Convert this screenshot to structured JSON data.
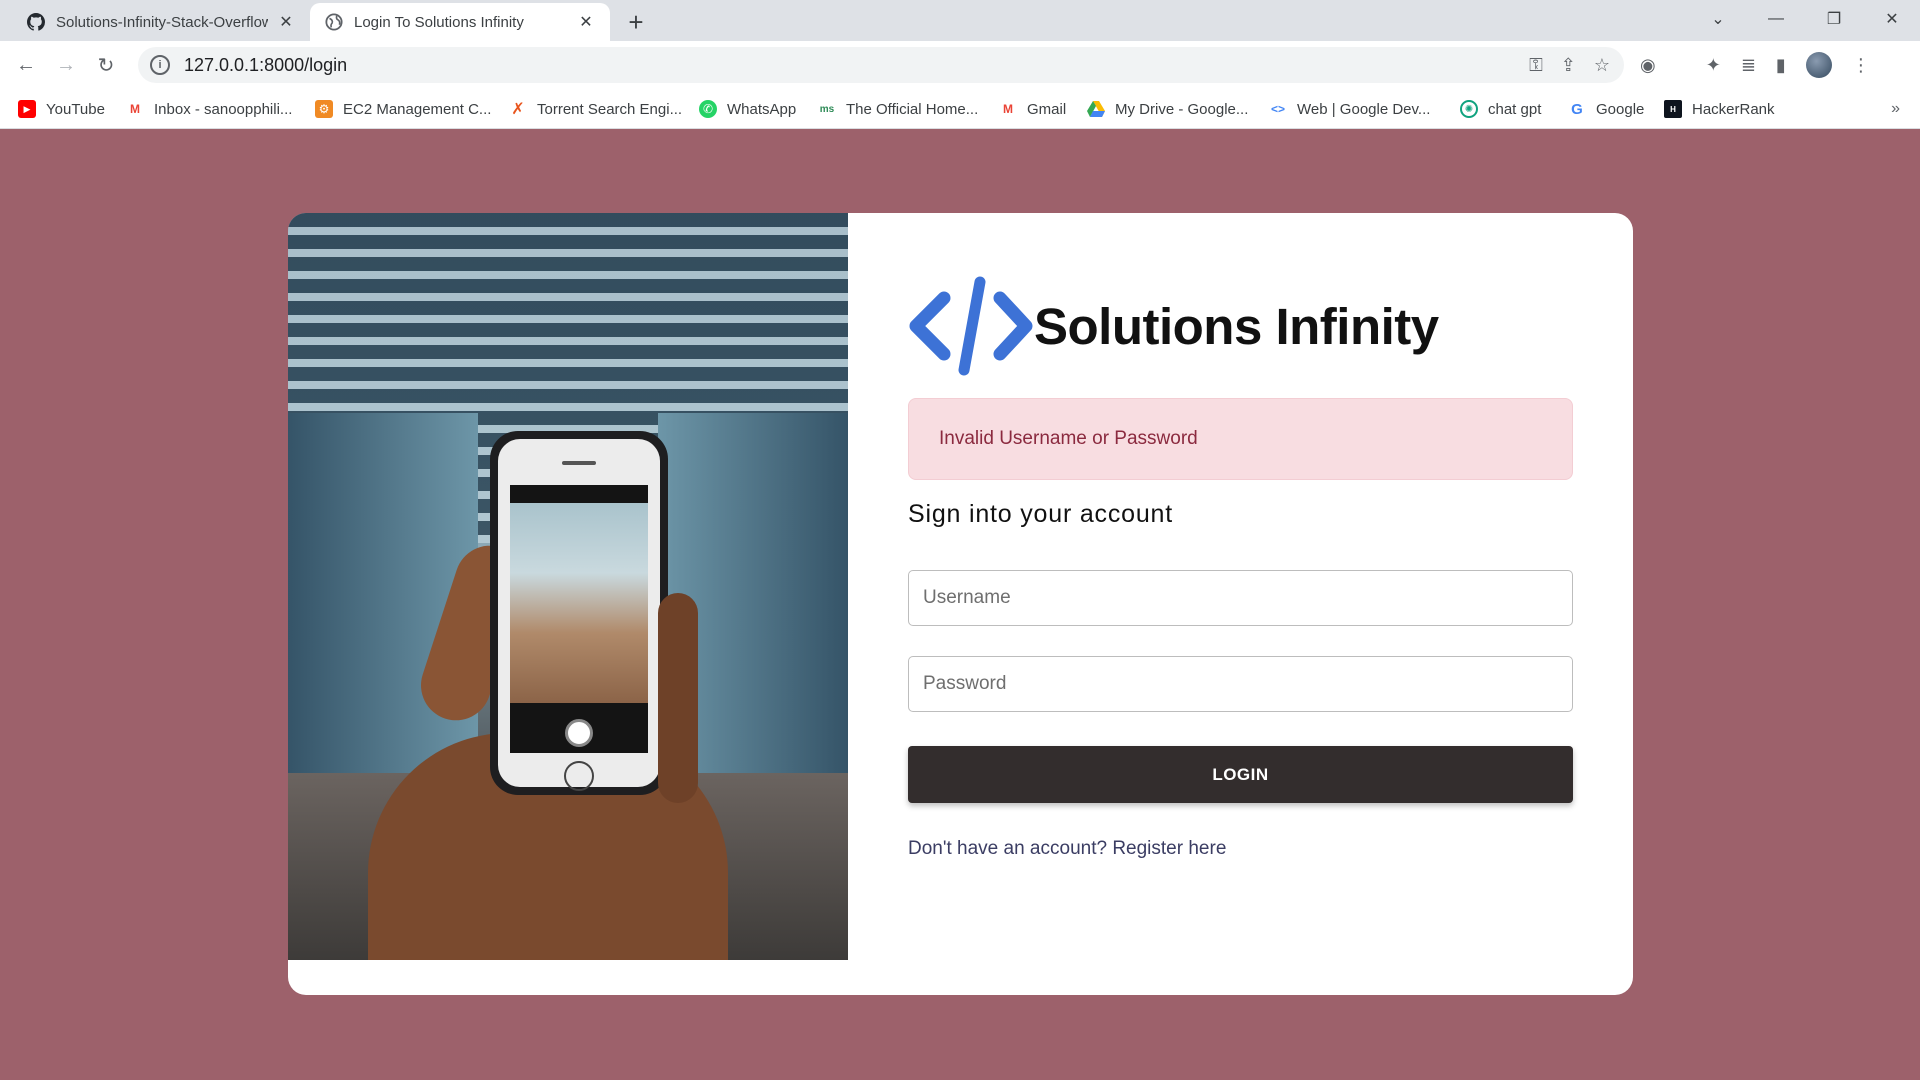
{
  "browser": {
    "tabs": [
      {
        "title": "Solutions-Infinity-Stack-Overflow",
        "icon": "github-icon"
      },
      {
        "title": "Login To Solutions Infinity",
        "icon": "globe-icon"
      }
    ],
    "url": "127.0.0.1:8000/login",
    "bookmarks": [
      {
        "label": "YouTube",
        "icon": "youtube-icon",
        "color": "#ff0000"
      },
      {
        "label": "Inbox - sanoopphili...",
        "icon": "gmail-icon",
        "color": "#ea4335"
      },
      {
        "label": "EC2 Management C...",
        "icon": "aws-icon",
        "color": "#f08a24"
      },
      {
        "label": "Torrent Search Engi...",
        "icon": "x-icon",
        "color": "#e8541c"
      },
      {
        "label": "WhatsApp",
        "icon": "whatsapp-icon",
        "color": "#25d366"
      },
      {
        "label": "The Official Home...",
        "icon": "site-icon",
        "color": "#2e8b57"
      },
      {
        "label": "Gmail",
        "icon": "gmail-icon",
        "color": "#ea4335"
      },
      {
        "label": "My Drive - Google...",
        "icon": "drive-icon",
        "color": "#fbbc04"
      },
      {
        "label": "Web  |  Google Dev...",
        "icon": "code-icon",
        "color": "#4285f4"
      },
      {
        "label": "chat gpt",
        "icon": "openai-icon",
        "color": "#10a37f"
      },
      {
        "label": "Google",
        "icon": "google-icon",
        "color": "#4285f4"
      },
      {
        "label": "HackerRank",
        "icon": "hackerrank-icon",
        "color": "#1ba94c"
      }
    ]
  },
  "page": {
    "brand": "Solutions Infinity",
    "alert": "Invalid Username or Password",
    "heading": "Sign into your account",
    "username_placeholder": "Username",
    "password_placeholder": "Password",
    "login_label": "LOGIN",
    "register_text": "Don't have an account? Register here"
  },
  "colors": {
    "background": "#9d616b",
    "logo_blue": "#3d72d6",
    "button": "#332d2d",
    "alert_bg": "#f8dde1",
    "alert_text": "#8b2a3f"
  }
}
